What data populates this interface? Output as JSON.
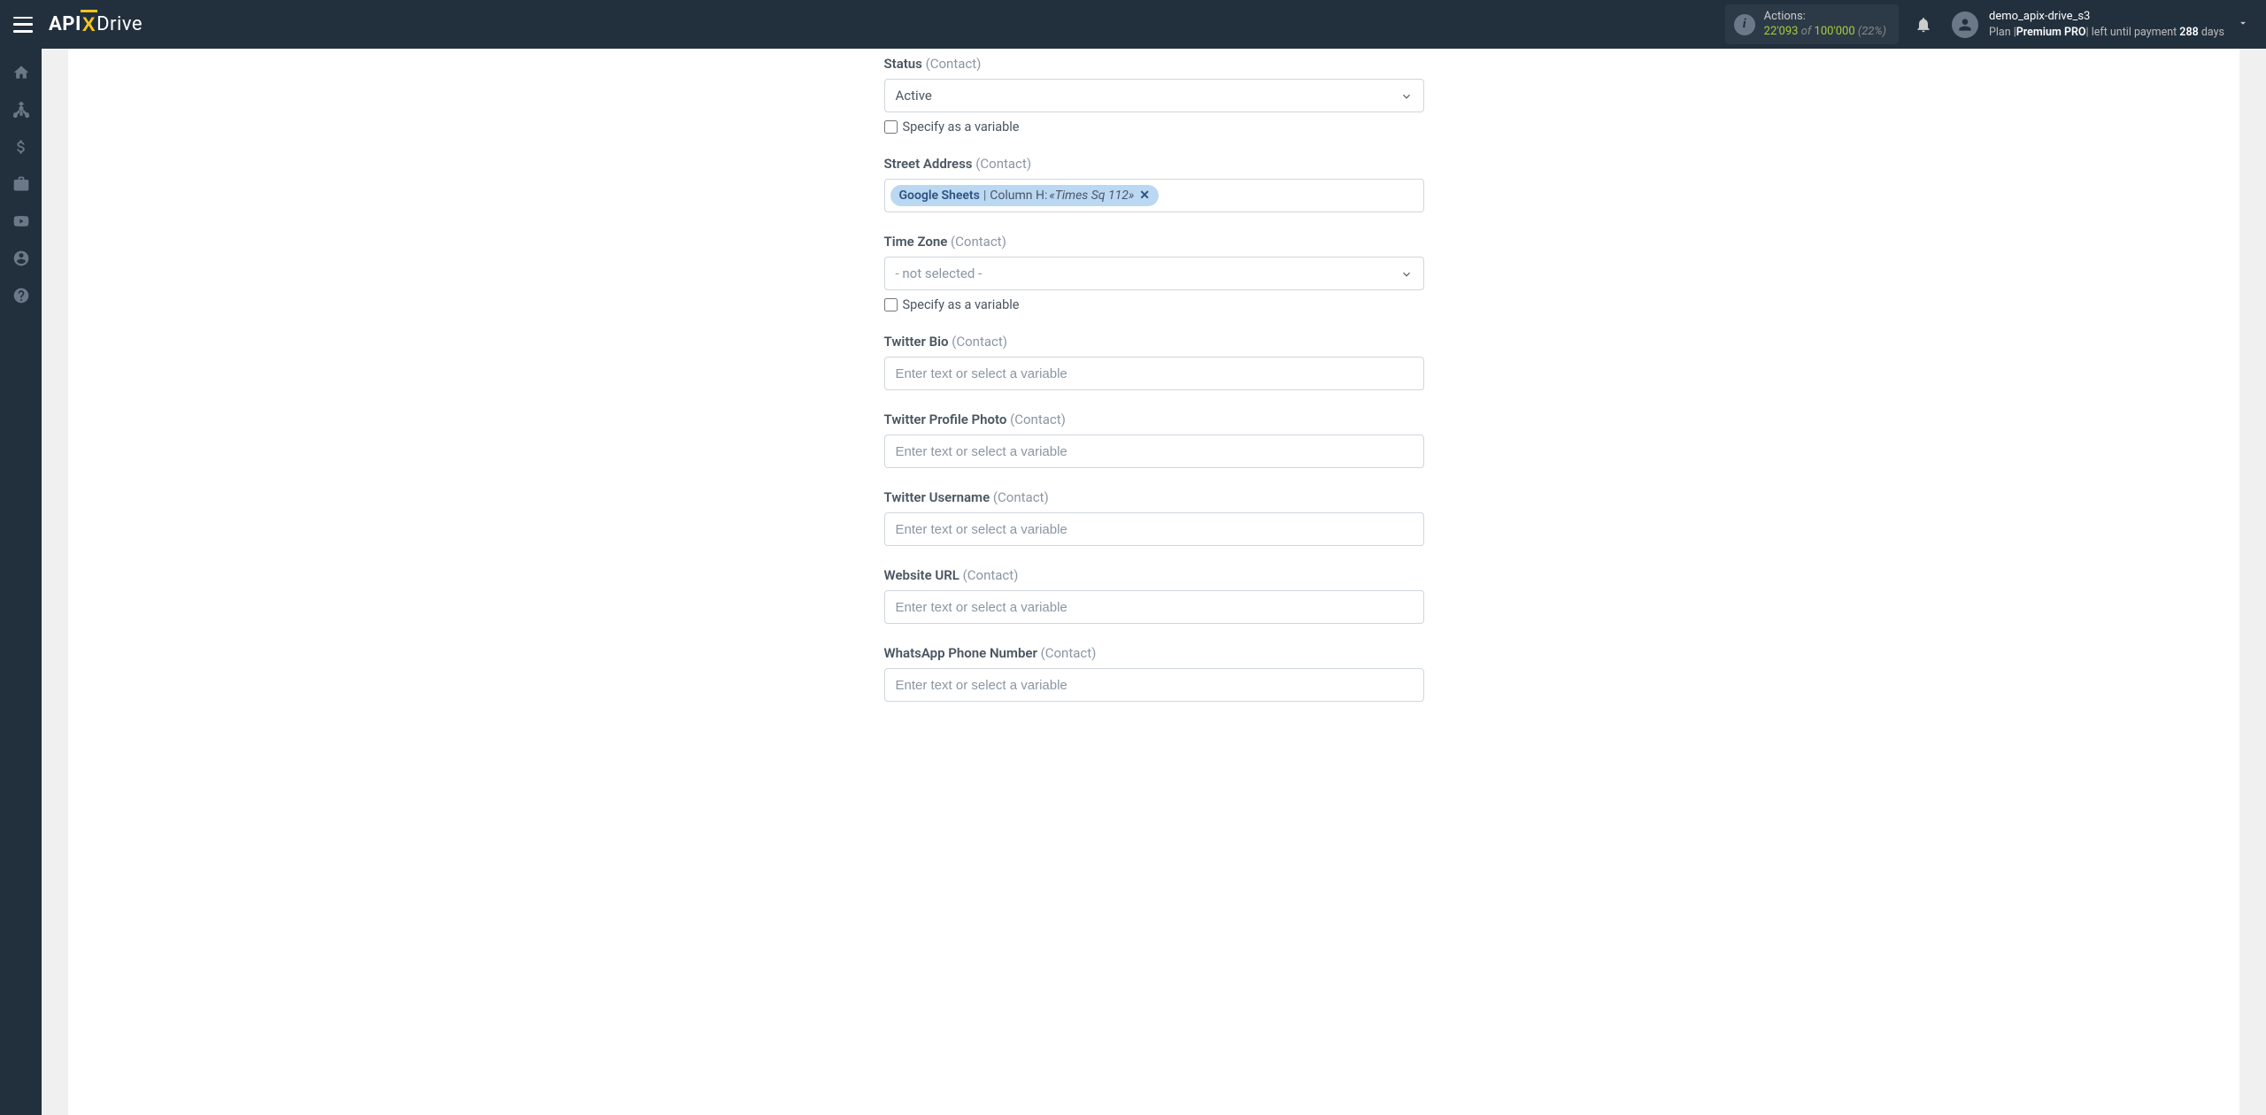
{
  "header": {
    "logo_api": "API",
    "logo_x": "X",
    "logo_drive": "Drive",
    "actions_label": "Actions:",
    "actions_count": "22'093",
    "actions_of": "of",
    "actions_total": "100'000",
    "actions_pct": "(22%)",
    "username": "demo_apix-drive_s3",
    "plan_prefix": "Plan |",
    "plan_name": "Premium PRO",
    "plan_mid": "| left until payment ",
    "plan_days": "288",
    "plan_suffix": " days"
  },
  "form": {
    "placeholder_text": "Enter text or select a variable",
    "specify_label": "Specify as a variable",
    "fields": [
      {
        "label": "Status",
        "sub": "(Contact)",
        "type": "select",
        "value": "Active",
        "has_checkbox": true
      },
      {
        "label": "Street Address",
        "sub": "(Contact)",
        "type": "tag",
        "tag_source": "Google Sheets",
        "tag_column": "Column H:",
        "tag_value": "«Times Sq 112»"
      },
      {
        "label": "Time Zone",
        "sub": "(Contact)",
        "type": "select",
        "value": "- not selected -",
        "is_placeholder": true,
        "has_checkbox": true
      },
      {
        "label": "Twitter Bio",
        "sub": "(Contact)",
        "type": "text"
      },
      {
        "label": "Twitter Profile Photo",
        "sub": "(Contact)",
        "type": "text"
      },
      {
        "label": "Twitter Username",
        "sub": "(Contact)",
        "type": "text"
      },
      {
        "label": "Website URL",
        "sub": "(Contact)",
        "type": "text"
      },
      {
        "label": "WhatsApp Phone Number",
        "sub": "(Contact)",
        "type": "text"
      }
    ]
  }
}
